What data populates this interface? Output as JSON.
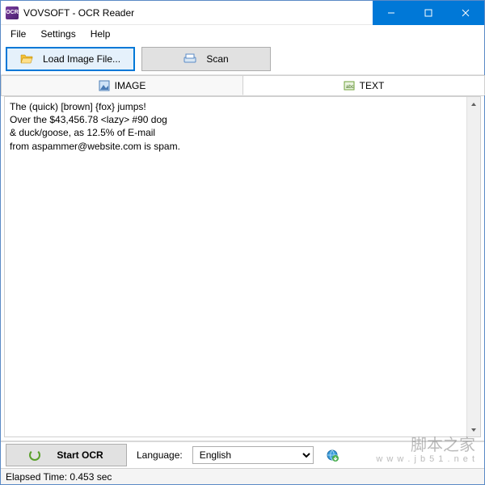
{
  "titlebar": {
    "title": "VOVSOFT - OCR Reader"
  },
  "menu": {
    "file": "File",
    "settings": "Settings",
    "help": "Help"
  },
  "toolbar": {
    "load_image": "Load Image File...",
    "scan": "Scan"
  },
  "tabs": {
    "image": "IMAGE",
    "text": "TEXT"
  },
  "ocr_text": "The (quick) [brown] {fox} jumps!\nOver the $43,456.78 <lazy> #90 dog\n& duck/goose, as 12.5% of E-mail\nfrom aspammer@website.com is spam.",
  "bottom": {
    "start_ocr": "Start OCR",
    "language_label": "Language:",
    "language_value": "English"
  },
  "status": {
    "elapsed": "Elapsed Time: 0.453 sec"
  },
  "watermark": {
    "text": "脚本之家",
    "url": "w w w . j b 5 1 . n e t"
  },
  "colors": {
    "accent": "#0078d7",
    "button_bg": "#e1e1e1",
    "border": "#adadad"
  }
}
